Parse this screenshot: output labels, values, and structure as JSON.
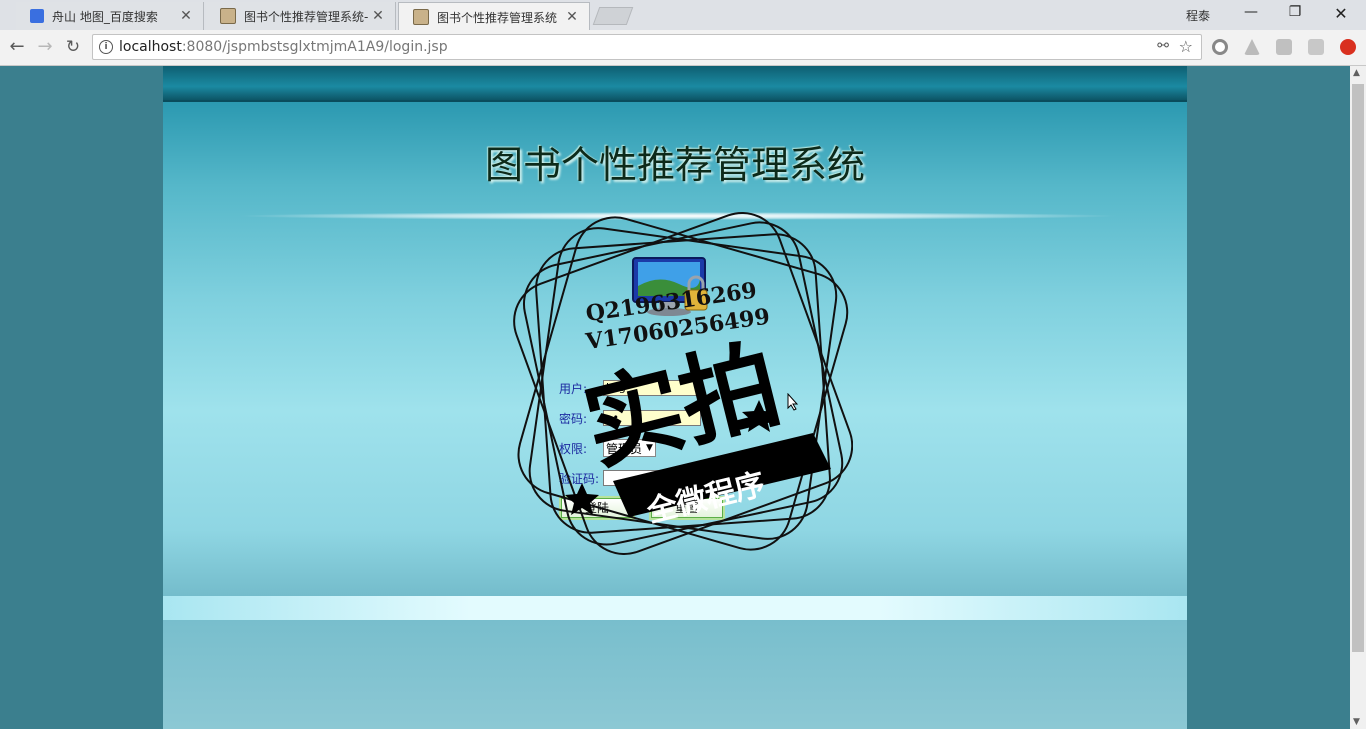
{
  "browser": {
    "tabs": [
      {
        "title": "舟山 地图_百度搜索",
        "active": false
      },
      {
        "title": "图书个性推荐管理系统-",
        "active": false
      },
      {
        "title": "图书个性推荐管理系统",
        "active": true
      }
    ],
    "profile_name": "程泰",
    "url_host": "localhost",
    "url_path": ":8080/jspmbstsglxtmjmA1A9/login.jsp"
  },
  "page": {
    "title": "图书个性推荐管理系统",
    "form": {
      "user_label": "用户:",
      "user_value": "hsg",
      "password_label": "密码:",
      "password_value": "••",
      "role_label": "权限:",
      "role_value": "管理员",
      "captcha_label": "验证码:",
      "captcha_image_text": "",
      "login_button": "登陆",
      "reset_button": "重置"
    },
    "watermark": {
      "line1": "Q2196316269",
      "line2": "V17060256499",
      "big": "实拍",
      "banner": "全微程序"
    }
  },
  "colors": {
    "page_bg": "#3b7f8e",
    "title_text": "#0d2a1a",
    "label_text": "#1c2aa0",
    "input_bg": "#ffffcc",
    "button_border": "#5cae47"
  }
}
